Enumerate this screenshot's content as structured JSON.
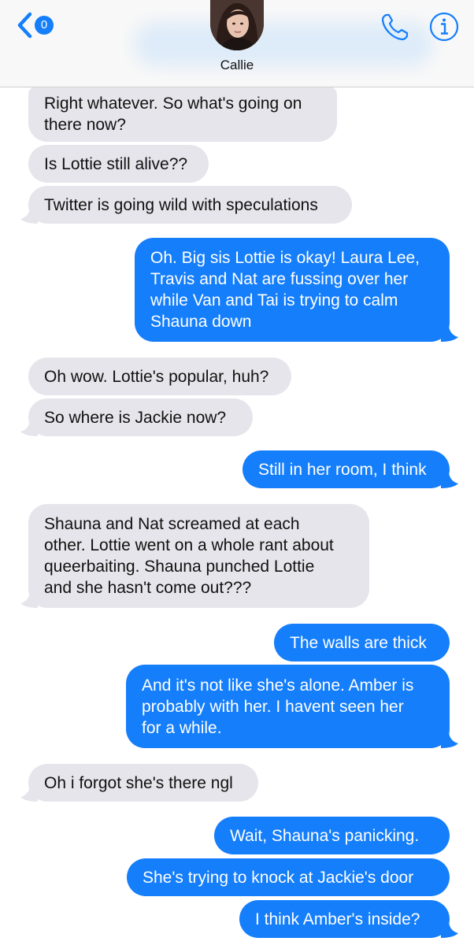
{
  "header": {
    "back_badge": "0",
    "contact_name": "Callie"
  },
  "colors": {
    "accent": "#147efb",
    "incoming_bubble": "#e6e5eb",
    "outgoing_bubble": "#157efb"
  },
  "icons": {
    "back": "chevron-left-icon",
    "phone": "phone-icon",
    "info": "info-icon"
  },
  "messages": [
    {
      "from": "contact",
      "text": "Right whatever. So what's going on\nthere now?"
    },
    {
      "from": "contact",
      "text": "Is Lottie still alive??"
    },
    {
      "from": "contact",
      "text": "Twitter is going wild with speculations"
    },
    {
      "from": "me",
      "text": "Oh. Big sis Lottie is okay! Laura Lee,\nTravis and Nat are fussing over her\nwhile Van and Tai is trying to calm\nShauna down"
    },
    {
      "from": "contact",
      "text": "Oh wow. Lottie's popular, huh?"
    },
    {
      "from": "contact",
      "text": "So where is Jackie now?"
    },
    {
      "from": "me",
      "text": "Still in her room, I think"
    },
    {
      "from": "contact",
      "text": "Shauna and Nat screamed at each\nother. Lottie went on a whole rant about\nqueerbaiting. Shauna punched Lottie\nand she hasn't come out???"
    },
    {
      "from": "me",
      "text": "The walls are thick"
    },
    {
      "from": "me",
      "text": "And it's not like she's alone. Amber is\nprobably with her. I havent seen her\nfor a while."
    },
    {
      "from": "contact",
      "text": "Oh i forgot she's there ngl"
    },
    {
      "from": "me",
      "text": "Wait, Shauna's panicking."
    },
    {
      "from": "me",
      "text": "She's trying to knock at Jackie's door"
    },
    {
      "from": "me",
      "text": "I think Amber's inside?"
    }
  ]
}
